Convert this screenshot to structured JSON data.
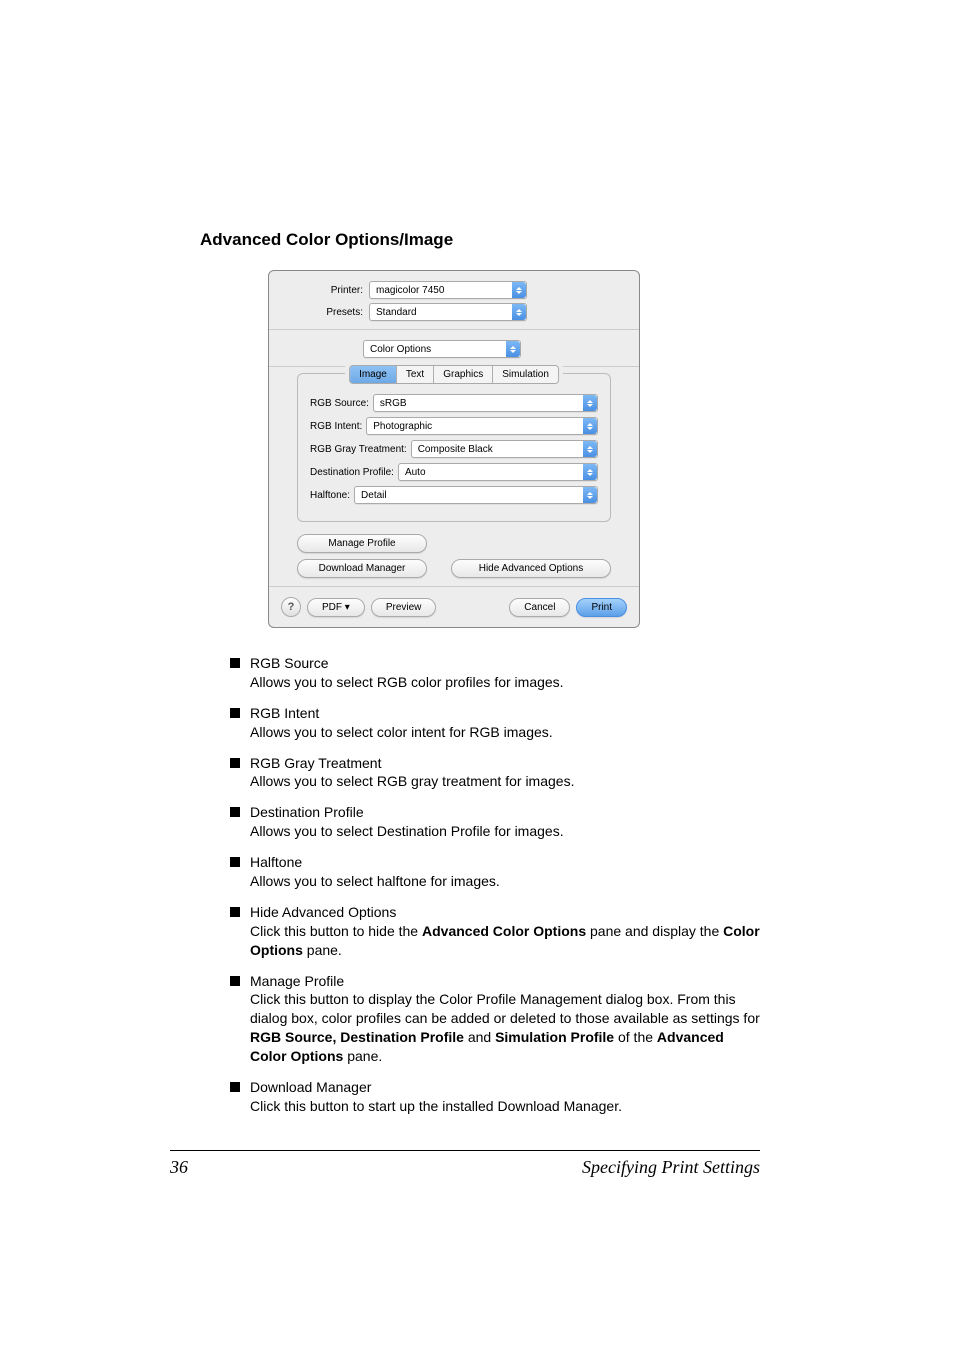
{
  "heading": "Advanced Color Options/Image",
  "dialog": {
    "printer_label": "Printer:",
    "printer_value": "magicolor 7450",
    "presets_label": "Presets:",
    "presets_value": "Standard",
    "panel_value": "Color Options",
    "tabs": {
      "image": "Image",
      "text": "Text",
      "graphics": "Graphics",
      "simulation": "Simulation"
    },
    "opts": {
      "rgb_source_label": "RGB Source:",
      "rgb_source_value": "sRGB",
      "rgb_intent_label": "RGB Intent:",
      "rgb_intent_value": "Photographic",
      "rgb_gray_label": "RGB Gray Treatment:",
      "rgb_gray_value": "Composite Black",
      "dest_profile_label": "Destination Profile:",
      "dest_profile_value": "Auto",
      "halftone_label": "Halftone:",
      "halftone_value": "Detail"
    },
    "buttons": {
      "manage_profile": "Manage Profile",
      "download_manager": "Download Manager",
      "hide_advanced": "Hide Advanced Options",
      "help": "?",
      "pdf": "PDF ▾",
      "preview": "Preview",
      "cancel": "Cancel",
      "print": "Print"
    }
  },
  "definitions": [
    {
      "term": "RGB Source",
      "desc": "Allows you to select RGB color profiles for images."
    },
    {
      "term": "RGB Intent",
      "desc": "Allows you to select color intent for RGB images."
    },
    {
      "term": "RGB Gray Treatment",
      "desc": "Allows you to select RGB gray treatment for images."
    },
    {
      "term": "Destination Profile",
      "desc": "Allows you to select Destination Profile for images."
    },
    {
      "term": "Halftone",
      "desc": "Allows you to select halftone for images."
    }
  ],
  "definitions_rich": {
    "hide": {
      "term": "Hide Advanced Options",
      "pre": "Click this button to hide the ",
      "b1": "Advanced Color Options",
      "mid": " pane and display the ",
      "b2": "Color Options",
      "post": " pane."
    },
    "manage": {
      "term": "Manage Profile",
      "line1": "Click this button to display the Color Profile Management dialog box. From this dialog box, color profiles can be added or deleted to those available as settings for ",
      "b1": "RGB Source, Destination Profile",
      "mid": " and ",
      "b2": "Simulation Profile",
      "mid2": " of the ",
      "b3": "Advanced Color Options",
      "post": " pane."
    },
    "download": {
      "term": "Download Manager",
      "desc": "Click this button to start up the installed Download Manager."
    }
  },
  "footer": {
    "page": "36",
    "title": "Specifying Print Settings"
  }
}
